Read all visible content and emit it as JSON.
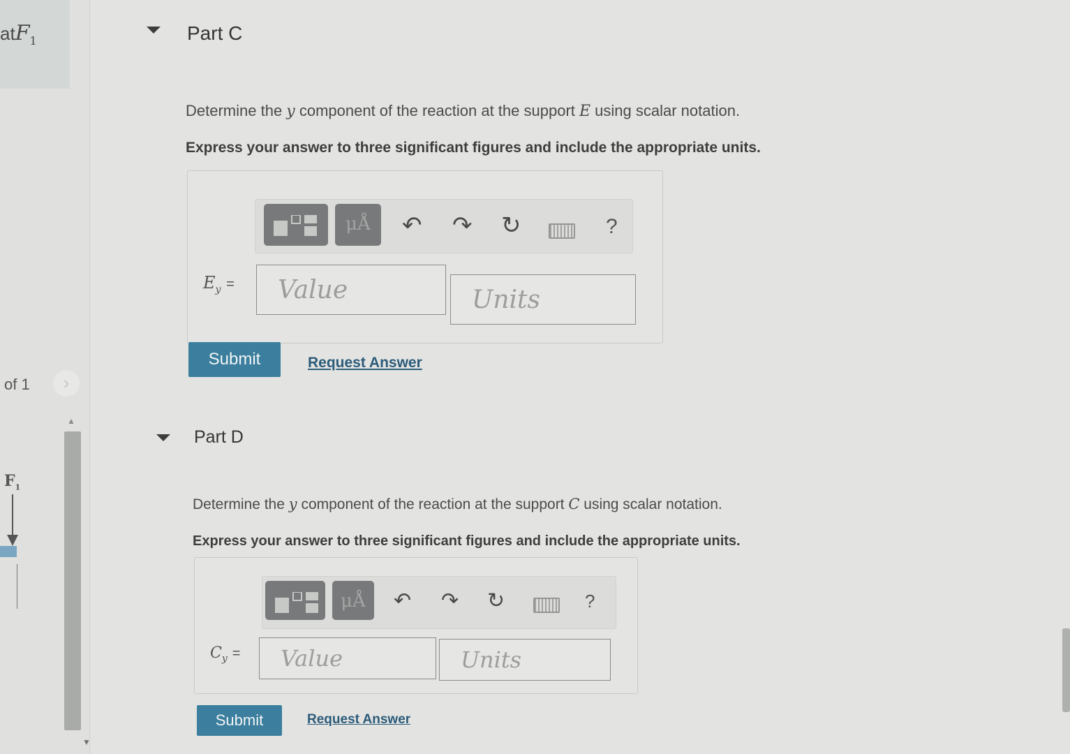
{
  "left_panel": {
    "header_prefix": "at",
    "header_var": "F",
    "header_sub": "1",
    "page_count": "of 1",
    "figure_label": "F",
    "figure_label_sub": "1"
  },
  "parts": [
    {
      "title": "Part C",
      "question_prefix": "Determine the ",
      "question_var": "y",
      "question_middle": " component of the reaction at the support ",
      "support_var": "E",
      "question_suffix": " using scalar notation.",
      "instruction": "Express your answer to three significant figures and include the appropriate units.",
      "variable": "E",
      "variable_sub": "y",
      "equals": "=",
      "units_glyph": "μÅ",
      "help": "?",
      "value_placeholder": "Value",
      "units_placeholder": "Units",
      "submit_label": "Submit",
      "request_label": "Request Answer"
    },
    {
      "title": "Part D",
      "question_prefix": "Determine the ",
      "question_var": "y",
      "question_middle": " component of the reaction at the support ",
      "support_var": "C",
      "question_suffix": " using scalar notation.",
      "instruction": "Express your answer to three significant figures and include the appropriate units.",
      "variable": "C",
      "variable_sub": "y",
      "equals": "=",
      "units_glyph": "μÅ",
      "help": "?",
      "value_placeholder": "Value",
      "units_placeholder": "Units",
      "submit_label": "Submit",
      "request_label": "Request Answer"
    }
  ],
  "icons": {
    "undo": "↶",
    "redo": "↷",
    "reset": "↻",
    "next": "›"
  }
}
